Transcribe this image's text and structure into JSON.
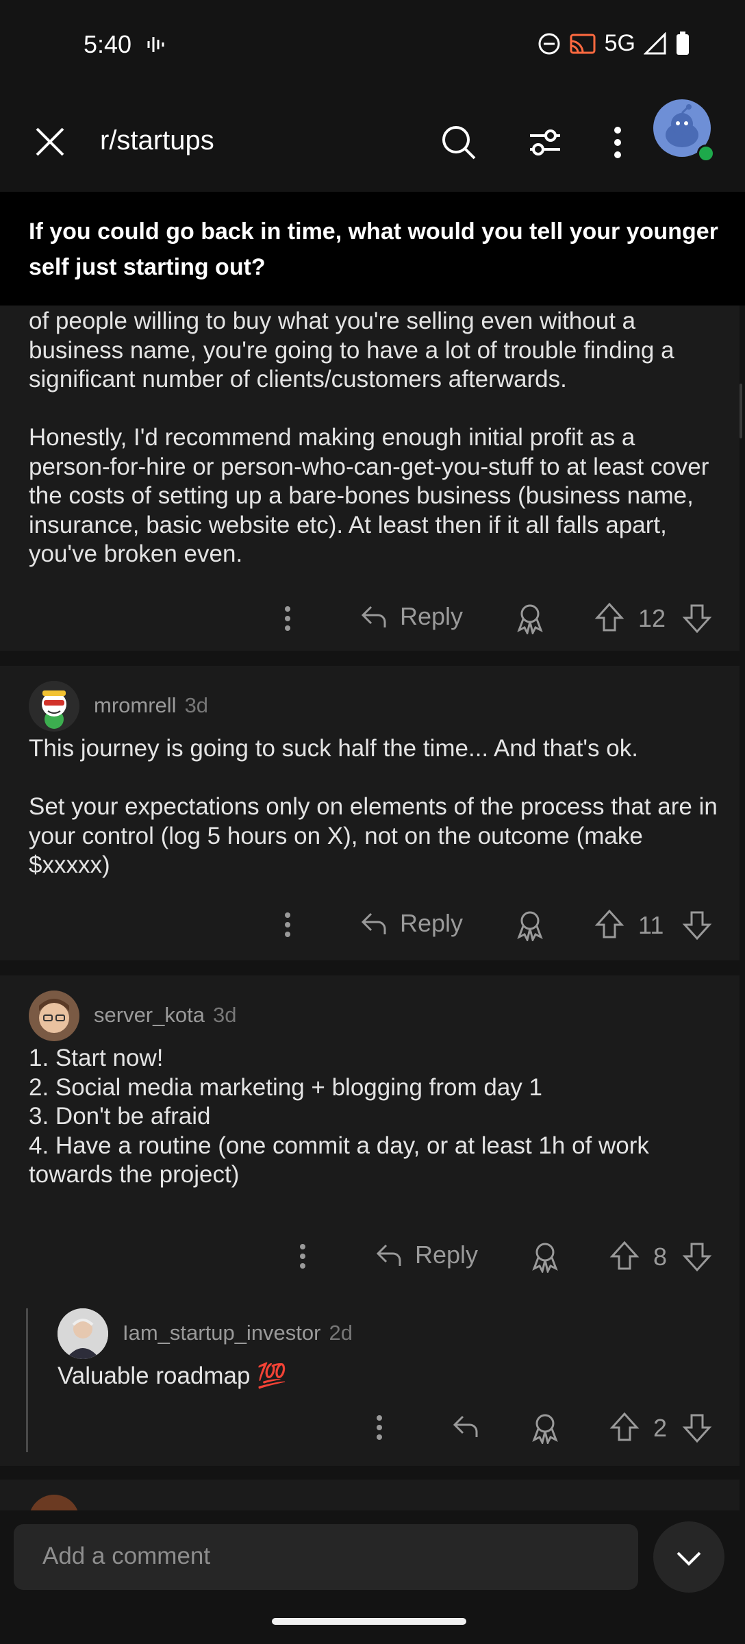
{
  "status_bar": {
    "time": "5:40",
    "network": "5G"
  },
  "header": {
    "subreddit": "r/startups"
  },
  "post": {
    "title": "If you could go back in time, what would you tell your younger self just starting out?"
  },
  "comments": [
    {
      "text": "of people willing to buy what you're selling even without a business name, you're going to have a lot of trouble finding a significant number of clients/customers afterwards.\n\nHonestly, I'd recommend making enough initial profit as a person-for-hire or person-who-can-get-you-stuff to at least cover the costs of setting up a bare-bones business (business name, insurance, basic website etc). At least then if it all falls apart, you've broken even.",
      "reply_label": "Reply",
      "votes": "12"
    },
    {
      "username": "mromrell",
      "age": "3d",
      "text": "This journey is going to suck half the time... And that's ok.\n\nSet your expectations only on elements of the process that are in your control (log 5 hours on X), not on the outcome (make $xxxxx)",
      "reply_label": "Reply",
      "votes": "11"
    },
    {
      "username": "server_kota",
      "age": "3d",
      "text": "1. Start now!\n2. Social media marketing + blogging from day 1\n3. Don't be afraid\n4. Have a routine (one commit a day, or at least 1h of work towards the project)",
      "reply_label": "Reply",
      "votes": "8",
      "reply": {
        "username": "Iam_startup_investor",
        "age": "2d",
        "text": "Valuable roadmap 💯",
        "votes": "2"
      }
    }
  ],
  "composer": {
    "placeholder": "Add a comment"
  },
  "colors": {
    "background": "#131313",
    "card": "#1b1b1b",
    "accent_online": "#1ea94b",
    "avatar_blue": "#6e8fd6"
  }
}
